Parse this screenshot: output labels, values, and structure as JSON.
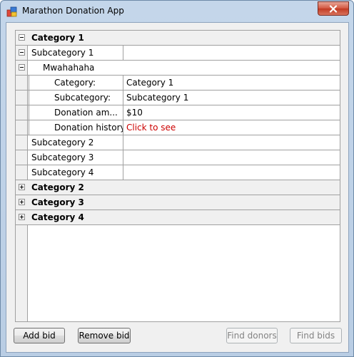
{
  "window": {
    "title": "Marathon Donation App"
  },
  "grid": {
    "categories": [
      {
        "label": "Category 1",
        "expanded": true
      },
      {
        "label": "Category 2",
        "expanded": false
      },
      {
        "label": "Category 3",
        "expanded": false
      },
      {
        "label": "Category 4",
        "expanded": false
      }
    ],
    "subcategories": [
      "Subcategory 1",
      "Subcategory 2",
      "Subcategory 3",
      "Subcategory 4"
    ],
    "bid": {
      "name": "Mwahahaha",
      "properties": [
        {
          "label": "Category:",
          "value": "Category 1"
        },
        {
          "label": "Subcategory:",
          "value": "Subcategory 1"
        },
        {
          "label": "Donation am...",
          "value": "$10"
        },
        {
          "label": "Donation history:",
          "value": "Click to see"
        }
      ]
    }
  },
  "buttons": {
    "add_bid": "Add bid",
    "remove_bid": "Remove bid",
    "find_donors": "Find donors",
    "find_bids": "Find bids"
  },
  "colors": {
    "link": "#cc0000",
    "grid_line": "#a0a0a0",
    "category_bg": "#f0f0f0"
  }
}
